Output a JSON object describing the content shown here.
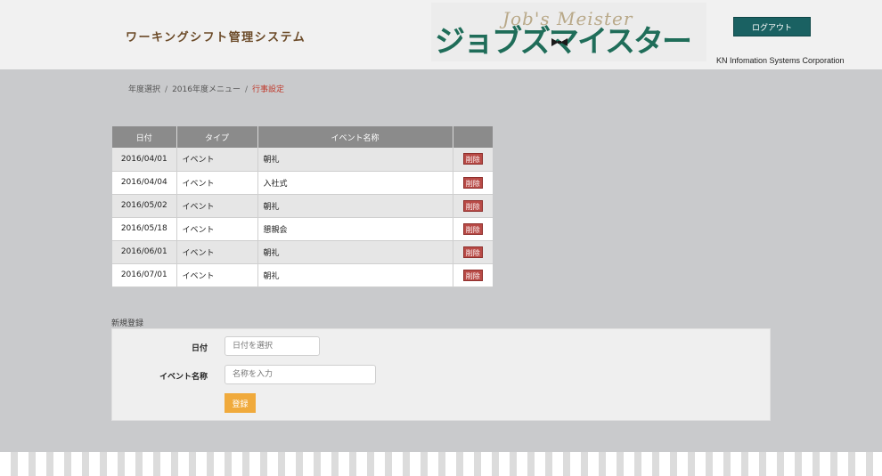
{
  "header": {
    "app_title": "ワーキングシフト管理システム",
    "logo": {
      "script": "Job's Meister",
      "main": "ジョブズマイスター"
    },
    "company": "KN Infomation Systems Corporation",
    "logout_label": "ログアウト"
  },
  "breadcrumb": {
    "items": [
      "年度選択",
      "2016年度メニュー"
    ],
    "current": "行事設定",
    "separator": "/"
  },
  "table": {
    "headers": [
      "日付",
      "タイプ",
      "イベント名称",
      ""
    ],
    "rows": [
      {
        "date": "2016/04/01",
        "type": "イベント",
        "name": "朝礼",
        "action": "削除"
      },
      {
        "date": "2016/04/04",
        "type": "イベント",
        "name": "入社式",
        "action": "削除"
      },
      {
        "date": "2016/05/02",
        "type": "イベント",
        "name": "朝礼",
        "action": "削除"
      },
      {
        "date": "2016/05/18",
        "type": "イベント",
        "name": "懇親会",
        "action": "削除"
      },
      {
        "date": "2016/06/01",
        "type": "イベント",
        "name": "朝礼",
        "action": "削除"
      },
      {
        "date": "2016/07/01",
        "type": "イベント",
        "name": "朝礼",
        "action": "削除"
      }
    ]
  },
  "form": {
    "section_title": "新規登録",
    "date_label": "日付",
    "date_placeholder": "日付を選択",
    "event_label": "イベント名称",
    "event_placeholder": "名称を入力",
    "submit_label": "登録"
  },
  "colors": {
    "header_bg": "#f1f1f1",
    "page_bg": "#c9cacc",
    "logout_bg": "#1a6162",
    "delete_bg": "#b84a46",
    "submit_bg": "#f0aa3c",
    "breadcrumb_current": "#c0392b"
  }
}
